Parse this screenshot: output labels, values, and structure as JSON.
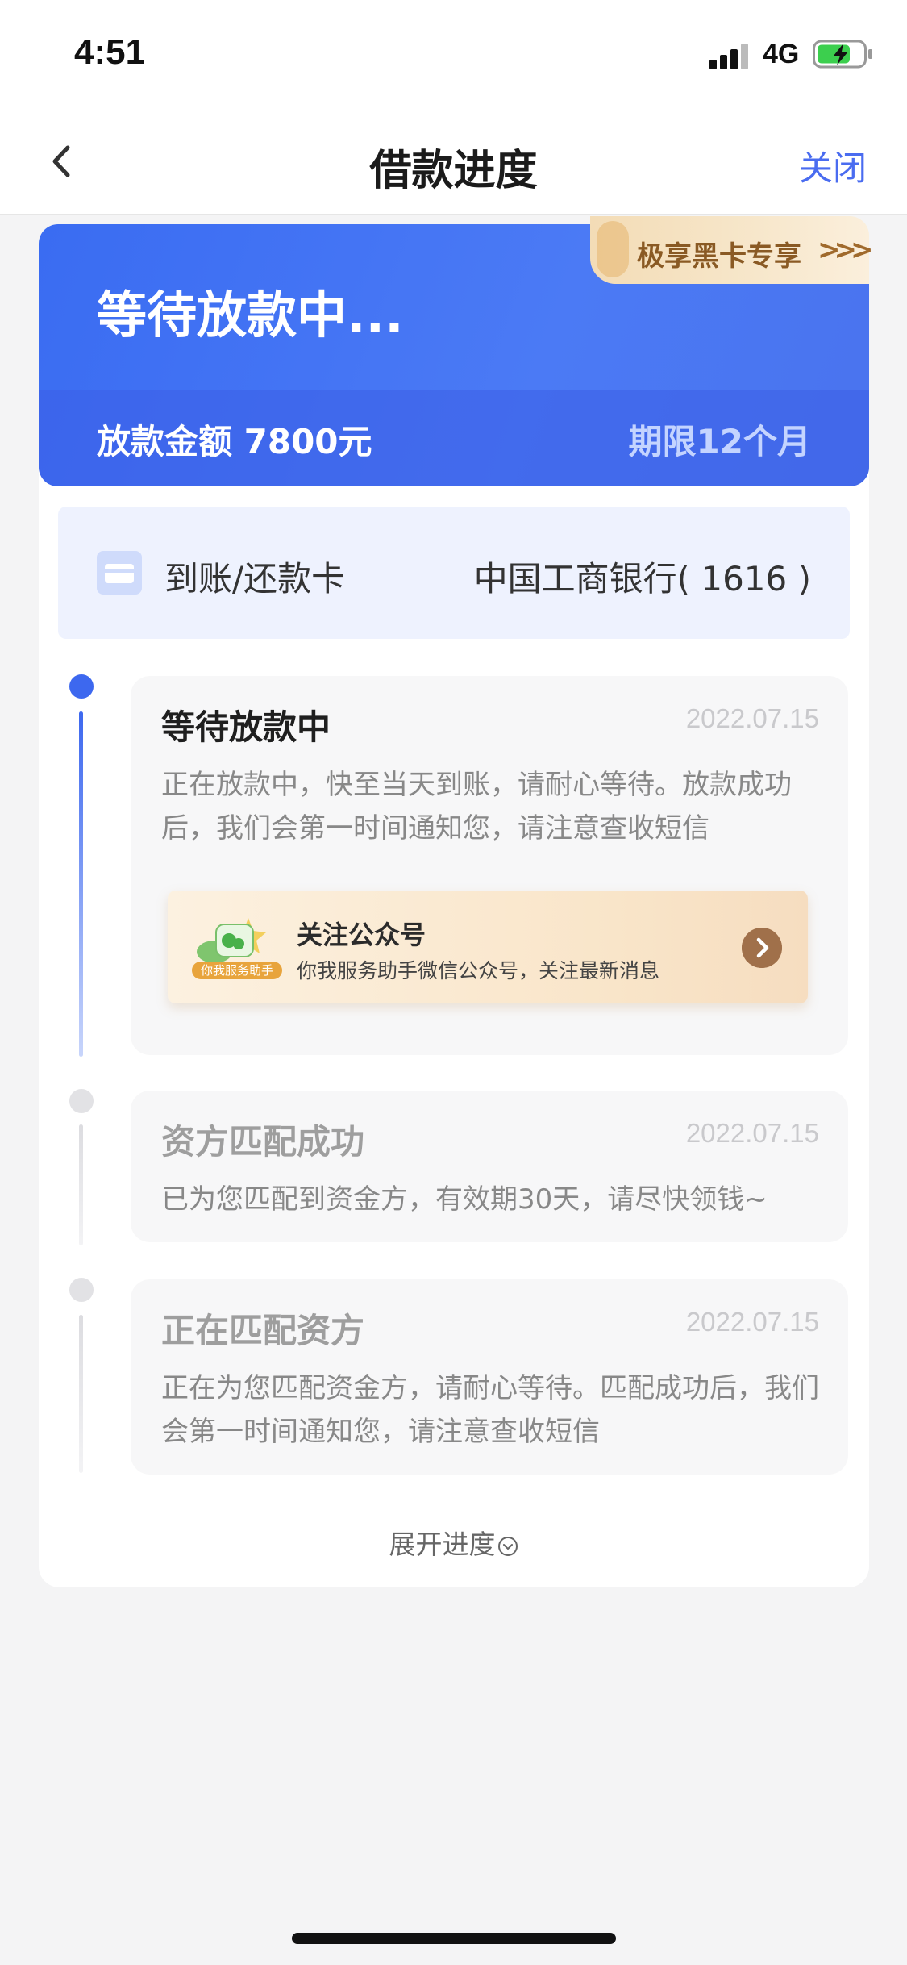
{
  "status_bar": {
    "time": "4:51",
    "network": "4G"
  },
  "nav": {
    "title": "借款进度",
    "close_label": "关闭"
  },
  "hero": {
    "status": "等待放款中...",
    "amount_label": "放款金额 7800元",
    "term_label": "期限12个月",
    "vip_label": "极享黑卡专享",
    "vip_arrow": ">>>"
  },
  "card": {
    "label": "到账/还款卡",
    "bank": "中国工商银行( 1616 )"
  },
  "steps": [
    {
      "title": "等待放款中",
      "date": "2022.07.15",
      "desc_line1": "正在放款中，快至当天到账，请耐心等待。放款成功",
      "desc_line2": "后，我们会第一时间通知您，请注意查收短信"
    },
    {
      "title": "资方匹配成功",
      "date": "2022.07.15",
      "desc_line1": "已为您匹配到资金方，有效期30天，请尽快领钱~"
    },
    {
      "title": "正在匹配资方",
      "date": "2022.07.15",
      "desc_line1": "正在为您匹配资金方，请耐心等待。匹配成功后，我们",
      "desc_line2": "会第一时间通知您，请注意查收短信"
    }
  ],
  "follow": {
    "title": "关注公众号",
    "desc": "你我服务助手微信公众号，关注最新消息",
    "icon_badge": "你我服务助手"
  },
  "expand_label": "展开进度",
  "colors": {
    "accent": "#4a6cf0",
    "hero_blue": "#3a6cf2",
    "vip_text": "#8a5a24"
  }
}
